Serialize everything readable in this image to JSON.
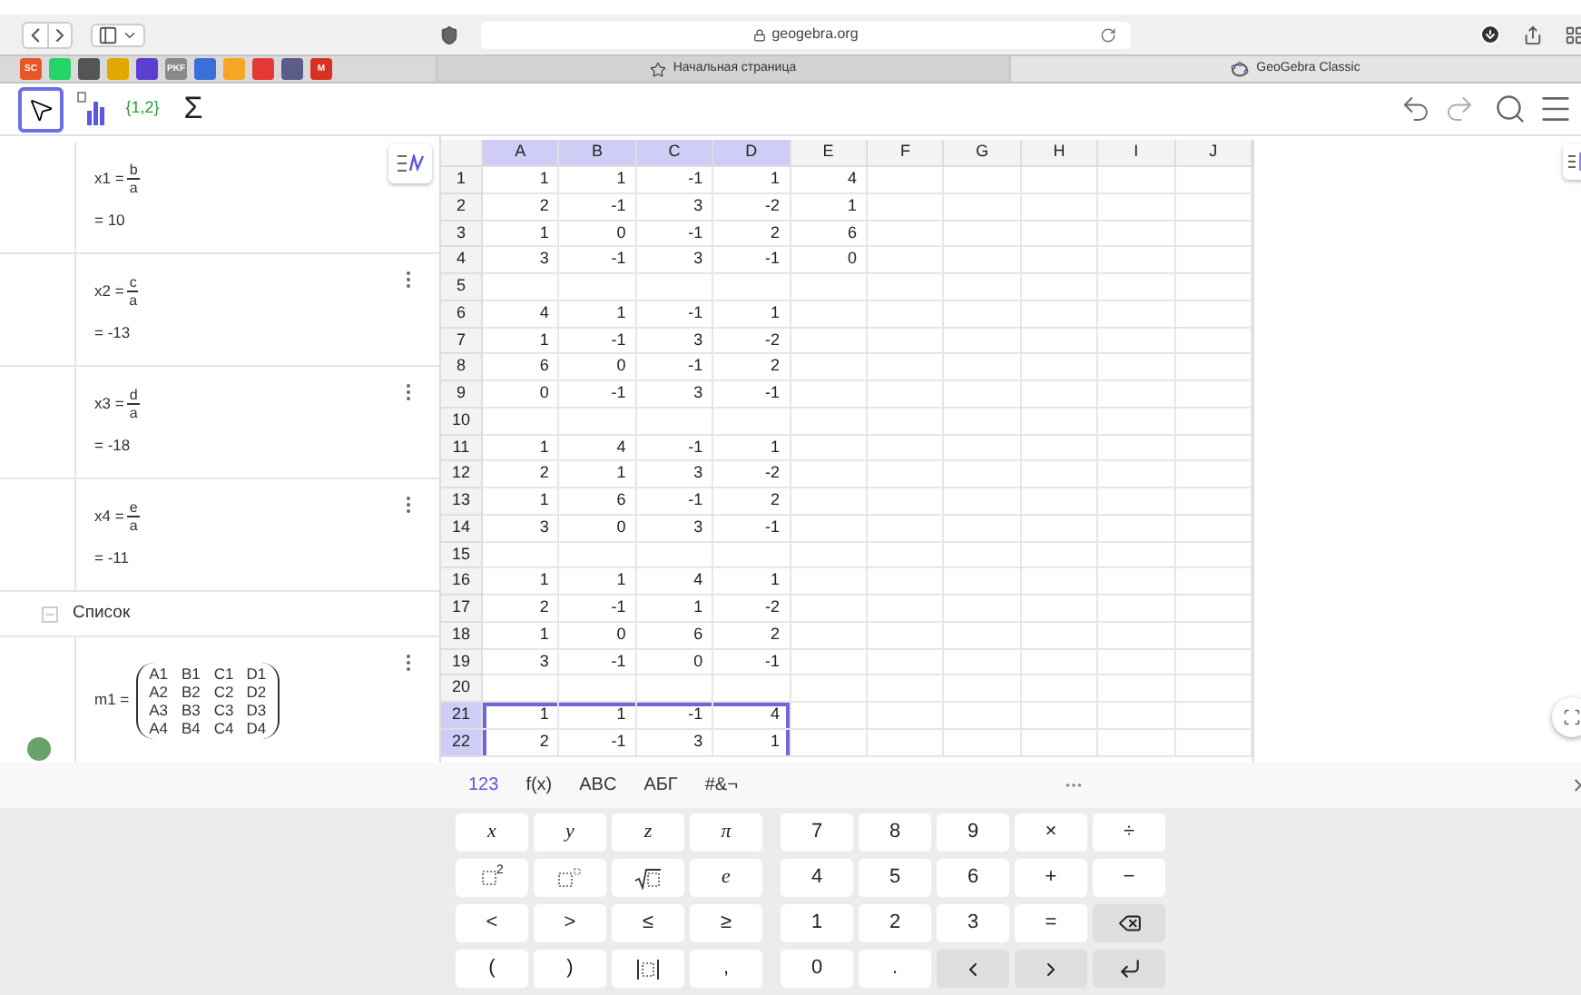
{
  "browser": {
    "address": "geogebra.org",
    "bookmarks": [
      {
        "label": "SC",
        "color": "#e8572a"
      },
      {
        "color": "#25d366"
      },
      {
        "color": "#555555"
      },
      {
        "color": "#e0a800"
      },
      {
        "color": "#5b3fd1"
      },
      {
        "label": "PKF",
        "color": "#8a8a8a"
      },
      {
        "color": "#3b6fd8"
      },
      {
        "color": "#f5a623"
      },
      {
        "color": "#e53935"
      },
      {
        "color": "#5c5c8a"
      },
      {
        "label": "M",
        "color": "#d93025"
      }
    ],
    "tabs": [
      {
        "kind": "start",
        "label": "Начальная страница",
        "selected": false
      },
      {
        "kind": "app",
        "label": "GeoGebra Classic",
        "selected": true
      }
    ]
  },
  "toolbar": {
    "tools": [
      {
        "kind": "move",
        "selected": true
      },
      {
        "kind": "chart",
        "selected": false
      },
      {
        "kind": "text",
        "label": "{1,2}",
        "selected": false
      },
      {
        "kind": "sum",
        "label": "Σ",
        "selected": false
      }
    ]
  },
  "algebra": {
    "items": [
      {
        "kind": "quotient",
        "label": "x1 =",
        "numerator": "b",
        "denominator": "a",
        "result": "= 10",
        "menu": false,
        "visible": false
      },
      {
        "kind": "quotient",
        "label": "x2 =",
        "numerator": "c",
        "denominator": "a",
        "result": "= -13",
        "menu": true,
        "visible": false
      },
      {
        "kind": "quotient",
        "label": "x3 =",
        "numerator": "d",
        "denominator": "a",
        "result": "= -18",
        "menu": true,
        "visible": false
      },
      {
        "kind": "quotient",
        "label": "x4 =",
        "numerator": "e",
        "denominator": "a",
        "result": "= -11",
        "menu": true,
        "visible": false
      },
      {
        "kind": "group",
        "label": "Список",
        "expanded": true
      },
      {
        "kind": "matrix",
        "label": "m1 =",
        "matrix": [
          [
            "A1",
            "B1",
            "C1",
            "D1"
          ],
          [
            "A2",
            "B2",
            "C2",
            "D2"
          ],
          [
            "A3",
            "B3",
            "C3",
            "D3"
          ],
          [
            "A4",
            "B4",
            "C4",
            "D4"
          ]
        ],
        "menu": true,
        "visible": true
      }
    ]
  },
  "spreadsheet": {
    "columns": [
      {
        "label": "A",
        "selected": true
      },
      {
        "label": "B",
        "selected": true
      },
      {
        "label": "C",
        "selected": true
      },
      {
        "label": "D",
        "selected": true
      },
      {
        "label": "E",
        "selected": false
      },
      {
        "label": "F",
        "selected": false
      },
      {
        "label": "G",
        "selected": false
      },
      {
        "label": "H",
        "selected": false
      },
      {
        "label": "I",
        "selected": false
      },
      {
        "label": "J",
        "selected": false
      }
    ],
    "rows": [
      {
        "label": "1",
        "selected": false,
        "cells": [
          "1",
          "1",
          "-1",
          "1",
          "4"
        ]
      },
      {
        "label": "2",
        "selected": false,
        "cells": [
          "2",
          "-1",
          "3",
          "-2",
          "1"
        ]
      },
      {
        "label": "3",
        "selected": false,
        "cells": [
          "1",
          "0",
          "-1",
          "2",
          "6"
        ]
      },
      {
        "label": "4",
        "selected": false,
        "cells": [
          "3",
          "-1",
          "3",
          "-1",
          "0"
        ]
      },
      {
        "label": "5",
        "selected": false,
        "cells": []
      },
      {
        "label": "6",
        "selected": false,
        "cells": [
          "4",
          "1",
          "-1",
          "1"
        ]
      },
      {
        "label": "7",
        "selected": false,
        "cells": [
          "1",
          "-1",
          "3",
          "-2"
        ]
      },
      {
        "label": "8",
        "selected": false,
        "cells": [
          "6",
          "0",
          "-1",
          "2"
        ]
      },
      {
        "label": "9",
        "selected": false,
        "cells": [
          "0",
          "-1",
          "3",
          "-1"
        ]
      },
      {
        "label": "10",
        "selected": false,
        "cells": []
      },
      {
        "label": "11",
        "selected": false,
        "cells": [
          "1",
          "4",
          "-1",
          "1"
        ]
      },
      {
        "label": "12",
        "selected": false,
        "cells": [
          "2",
          "1",
          "3",
          "-2"
        ]
      },
      {
        "label": "13",
        "selected": false,
        "cells": [
          "1",
          "6",
          "-1",
          "2"
        ]
      },
      {
        "label": "14",
        "selected": false,
        "cells": [
          "3",
          "0",
          "3",
          "-1"
        ]
      },
      {
        "label": "15",
        "selected": false,
        "cells": []
      },
      {
        "label": "16",
        "selected": false,
        "cells": [
          "1",
          "1",
          "4",
          "1"
        ]
      },
      {
        "label": "17",
        "selected": false,
        "cells": [
          "2",
          "-1",
          "1",
          "-2"
        ]
      },
      {
        "label": "18",
        "selected": false,
        "cells": [
          "1",
          "0",
          "6",
          "2"
        ]
      },
      {
        "label": "19",
        "selected": false,
        "cells": [
          "3",
          "-1",
          "0",
          "-1"
        ]
      },
      {
        "label": "20",
        "selected": false,
        "cells": []
      },
      {
        "label": "21",
        "selected": true,
        "cells": [
          "1",
          "1",
          "-1",
          "4"
        ]
      },
      {
        "label": "22",
        "selected": true,
        "cells": [
          "2",
          "-1",
          "3",
          "1"
        ]
      }
    ]
  },
  "keyboard": {
    "tabs": [
      {
        "label": "123",
        "selected": true
      },
      {
        "label": "f(x)",
        "selected": false
      },
      {
        "label": "ABC",
        "selected": false
      },
      {
        "label": "АБГ",
        "selected": false
      },
      {
        "label": "#&¬",
        "selected": false
      }
    ],
    "left_keys": [
      {
        "kind": "var",
        "label": "x"
      },
      {
        "kind": "var",
        "label": "y"
      },
      {
        "kind": "var",
        "label": "z"
      },
      {
        "kind": "var",
        "label": "π"
      },
      {
        "kind": "square",
        "label": "2"
      },
      {
        "kind": "power"
      },
      {
        "kind": "sqrt"
      },
      {
        "kind": "var",
        "label": "e"
      },
      {
        "kind": "char",
        "label": "<"
      },
      {
        "kind": "char",
        "label": ">"
      },
      {
        "kind": "char",
        "label": "≤"
      },
      {
        "kind": "char",
        "label": "≥"
      },
      {
        "kind": "char",
        "label": "("
      },
      {
        "kind": "char",
        "label": ")"
      },
      {
        "kind": "abs"
      },
      {
        "kind": "char",
        "label": ","
      }
    ],
    "right_keys": [
      {
        "kind": "char",
        "label": "7"
      },
      {
        "kind": "char",
        "label": "8"
      },
      {
        "kind": "char",
        "label": "9"
      },
      {
        "kind": "char",
        "label": "×"
      },
      {
        "kind": "char",
        "label": "÷"
      },
      {
        "kind": "char",
        "label": "4"
      },
      {
        "kind": "char",
        "label": "5"
      },
      {
        "kind": "char",
        "label": "6"
      },
      {
        "kind": "char",
        "label": "+"
      },
      {
        "kind": "char",
        "label": "−"
      },
      {
        "kind": "char",
        "label": "1"
      },
      {
        "kind": "char",
        "label": "2"
      },
      {
        "kind": "char",
        "label": "3"
      },
      {
        "kind": "char",
        "label": "="
      },
      {
        "kind": "backspace"
      },
      {
        "kind": "char",
        "label": "0"
      },
      {
        "kind": "char",
        "label": "."
      },
      {
        "kind": "left"
      },
      {
        "kind": "right"
      },
      {
        "kind": "enter"
      }
    ]
  }
}
